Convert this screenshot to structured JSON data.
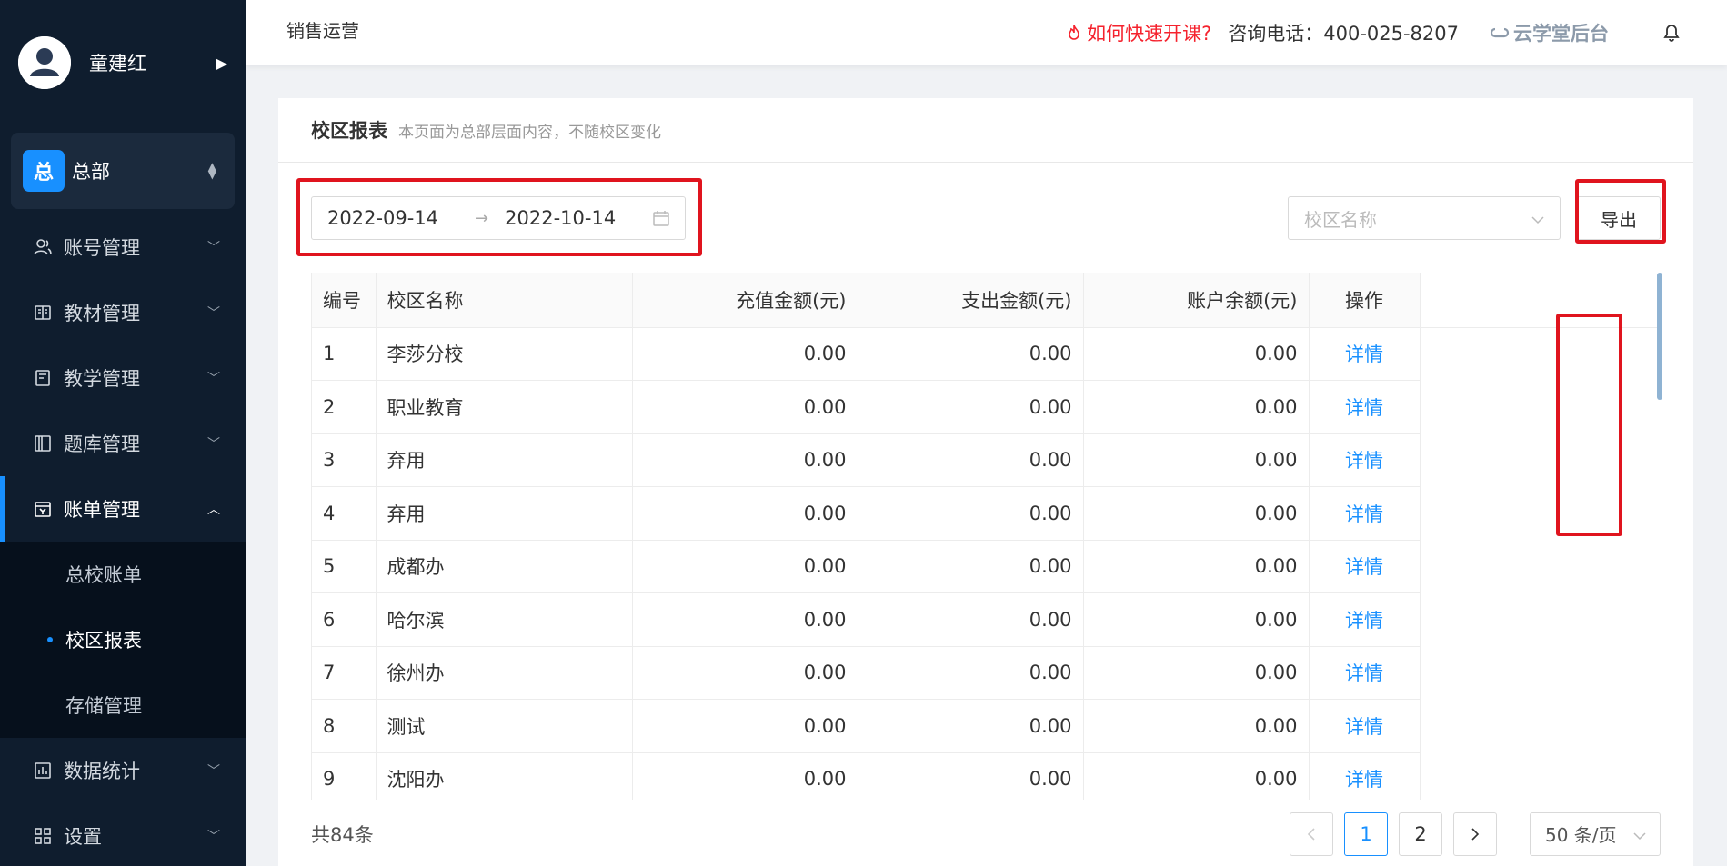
{
  "sidebar": {
    "user_name": "童建红",
    "org": {
      "badge": "总",
      "name": "总部"
    },
    "menu": [
      {
        "label": "账号管理",
        "icon": "user-icon"
      },
      {
        "label": "教材管理",
        "icon": "book-open-icon"
      },
      {
        "label": "教学管理",
        "icon": "notebook-icon"
      },
      {
        "label": "题库管理",
        "icon": "library-icon"
      },
      {
        "label": "账单管理",
        "icon": "bill-icon",
        "active": true
      },
      {
        "label": "数据统计",
        "icon": "chart-icon"
      },
      {
        "label": "设置",
        "icon": "grid-icon"
      }
    ],
    "submenu": [
      {
        "label": "总校账单"
      },
      {
        "label": "校区报表",
        "active": true
      },
      {
        "label": "存储管理"
      }
    ]
  },
  "header": {
    "title": "销售运营",
    "quick_start": "如何快速开课?",
    "hotline": "咨询电话：400-025-8207",
    "brand": "云学堂后台"
  },
  "page": {
    "title": "校区报表",
    "subtitle": "本页面为总部层面内容，不随校区变化"
  },
  "filters": {
    "date_start": "2022-09-14",
    "date_end": "2022-10-14",
    "school_placeholder": "校区名称",
    "export_label": "导出"
  },
  "table": {
    "headers": [
      "编号",
      "校区名称",
      "充值金额(元)",
      "支出金额(元)",
      "账户余额(元)",
      "操作"
    ],
    "action_label": "详情",
    "rows": [
      {
        "id": "1",
        "name": "李莎分校",
        "recharge": "0.00",
        "expense": "0.00",
        "balance": "0.00"
      },
      {
        "id": "2",
        "name": "职业教育",
        "recharge": "0.00",
        "expense": "0.00",
        "balance": "0.00"
      },
      {
        "id": "3",
        "name": "弃用",
        "recharge": "0.00",
        "expense": "0.00",
        "balance": "0.00"
      },
      {
        "id": "4",
        "name": "弃用",
        "recharge": "0.00",
        "expense": "0.00",
        "balance": "0.00"
      },
      {
        "id": "5",
        "name": "成都办",
        "recharge": "0.00",
        "expense": "0.00",
        "balance": "0.00"
      },
      {
        "id": "6",
        "name": "哈尔滨",
        "recharge": "0.00",
        "expense": "0.00",
        "balance": "0.00"
      },
      {
        "id": "7",
        "name": "徐州办",
        "recharge": "0.00",
        "expense": "0.00",
        "balance": "0.00"
      },
      {
        "id": "8",
        "name": "测试",
        "recharge": "0.00",
        "expense": "0.00",
        "balance": "0.00"
      },
      {
        "id": "9",
        "name": "沈阳办",
        "recharge": "0.00",
        "expense": "0.00",
        "balance": "0.00"
      }
    ]
  },
  "pager": {
    "total": "共84条",
    "pages": [
      "1",
      "2"
    ],
    "current": "1",
    "page_size": "50 条/页"
  },
  "colors": {
    "accent": "#1890ff",
    "highlight_box": "#e0141e",
    "sidebar_bg": "#0f1d2e",
    "alert": "#f5222d"
  }
}
